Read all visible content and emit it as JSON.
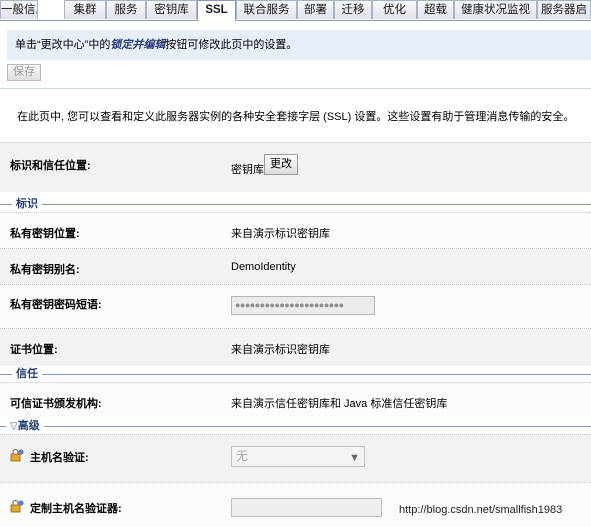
{
  "tabs": [
    {
      "label": "一般信息"
    },
    {
      "label": "集群"
    },
    {
      "label": "服务"
    },
    {
      "label": "密钥库"
    },
    {
      "label": "SSL",
      "active": true
    },
    {
      "label": "联合服务"
    },
    {
      "label": "部署"
    },
    {
      "label": "迁移"
    },
    {
      "label": "优化"
    },
    {
      "label": "超载"
    },
    {
      "label": "健康状况监视"
    },
    {
      "label": "服务器启"
    }
  ],
  "info": {
    "prefix": "单击“更改中心”中的",
    "emphasis": "锁定并编辑",
    "suffix": "按钮可修改此页中的设置。"
  },
  "save_label": "保存",
  "description": "在此页中, 您可以查看和定义此服务器实例的各种安全套接字层 (SSL) 设置。这些设置有助于管理消息传输的安全。",
  "identity_trust": {
    "label": "标识和信任位置:",
    "value": "密钥库",
    "change_label": "更改"
  },
  "sections": {
    "identity": "标识",
    "trust": "信任",
    "advanced": "高级"
  },
  "fields": {
    "private_key_location": {
      "label": "私有密钥位置:",
      "value": "来自演示标识密钥库"
    },
    "private_key_alias": {
      "label": "私有密钥别名:",
      "value": "DemoIdentity"
    },
    "private_key_passphrase": {
      "label": "私有密钥密码短语:",
      "value": "●●●●●●●●●●●●●●●●●●●●●●"
    },
    "certificate_location": {
      "label": "证书位置:",
      "value": "来自演示标识密钥库"
    },
    "trusted_ca": {
      "label": "可信证书颁发机构:",
      "value": "来自演示信任密钥库和 Java 标准信任密钥库"
    },
    "hostname_verification": {
      "label": "主机名验证:",
      "value": "无"
    },
    "custom_hostname_verifier": {
      "label": "定制主机名验证器:",
      "value": ""
    }
  },
  "watermark": "http://blog.csdn.net/smallfish1983",
  "colors": {
    "section_line": "#7f9bc0",
    "section_title": "#233f73",
    "info_bg": "#e8eef7"
  }
}
